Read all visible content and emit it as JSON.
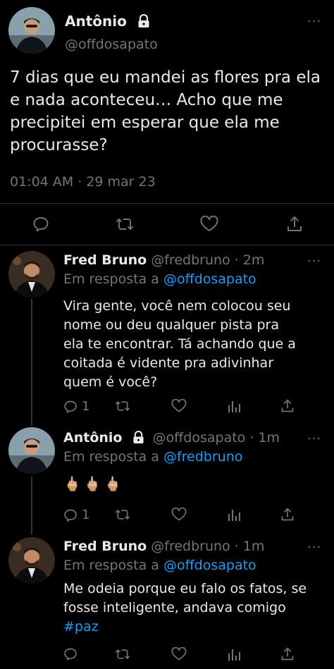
{
  "main_tweet": {
    "name": "Antônio",
    "handle": "@offdosapato",
    "text": "7 dias que eu mandei as flores pra ela e nada aconteceu… Acho que me precipitei em esperar que ela me procurasse?",
    "timestamp": "01:04 AM · 29 mar 23",
    "more_icon": "more-horizontal-icon",
    "actions": [
      "reply-icon",
      "retweet-icon",
      "like-icon",
      "share-icon"
    ]
  },
  "replies": [
    {
      "name": "Fred Bruno",
      "handle": "@fredbruno",
      "time": "· 2m",
      "reply_prefix": "Em resposta a",
      "reply_to": "@offdosapato",
      "text": "Vira gente, você nem colocou seu nome ou deu qualquer pista pra ela te encontrar. Tá achando que a coitada é vidente pra adivinhar quem é você?",
      "reply_count": "1"
    },
    {
      "name": "Antônio",
      "handle": "@offdosapato",
      "time": "· 1m",
      "reply_prefix": "Em resposta a",
      "reply_to": "@fredbruno",
      "text": "🖕🏼🖕🏼🖕🏼",
      "reply_count": "1"
    },
    {
      "name": "Fred Bruno",
      "handle": "@fredbruno",
      "time": "· 1m",
      "reply_prefix": "Em resposta a",
      "reply_to": "@offdosapato",
      "text_main": "Me odeia porque eu falo os fatos, se fosse inteligente, andava comigo ",
      "hashtag": "#paz"
    }
  ],
  "colors": {
    "background": "#000000",
    "text": "#e7e9ea",
    "muted": "#71767b",
    "link": "#1d9bf0",
    "divider": "#2f3336"
  }
}
